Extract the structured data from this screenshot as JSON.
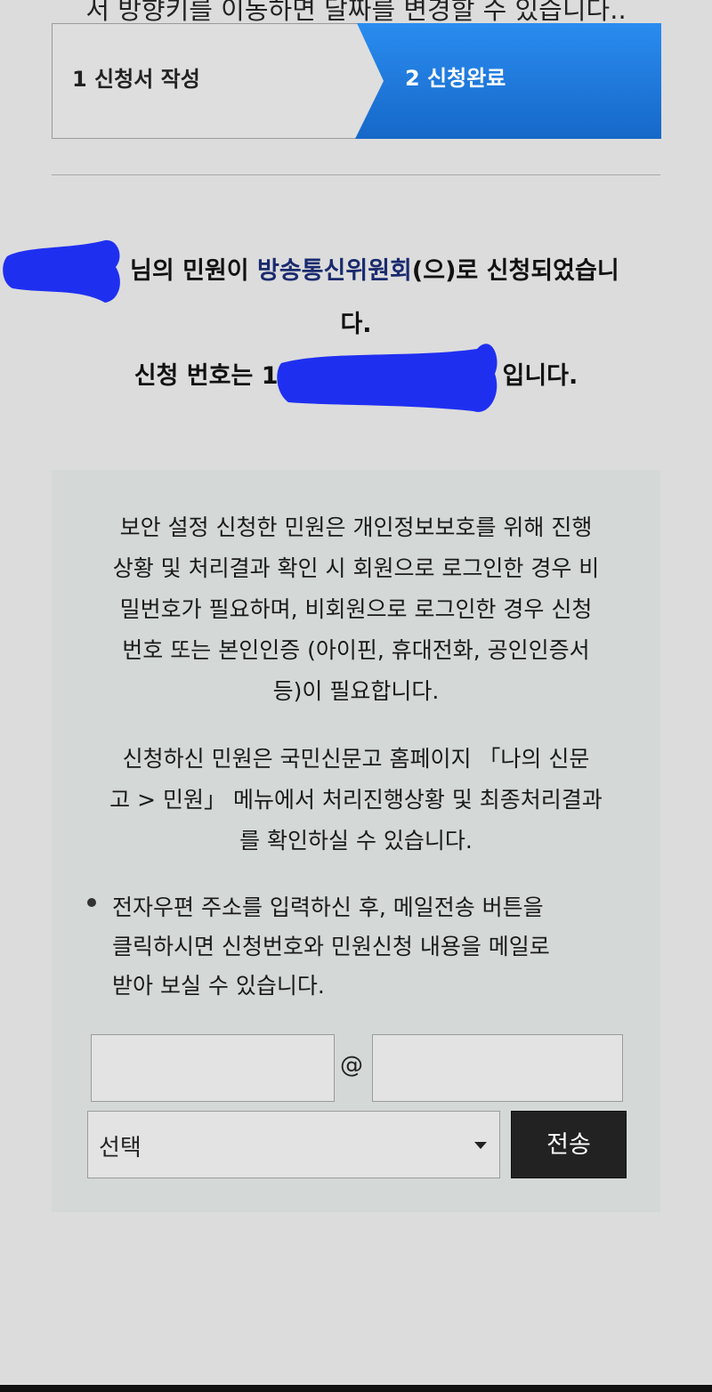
{
  "top_text": "서 방향키를 이동하면 달짜를 변경할 수 있습니다..",
  "steps": [
    {
      "label": "1 신청서 작성"
    },
    {
      "label": "2 신청완료"
    }
  ],
  "result": {
    "line1_prefix": "님의 민원이 ",
    "agency": "방송통신위원회",
    "line1_suffix": "(으)로 신청되었습니",
    "line2": "다.",
    "line3_prefix": "신청 번호는 1",
    "line3_suffix": "입니다."
  },
  "info": {
    "paragraph1_lines": [
      "보안 설정 신청한 민원은 개인정보보호를 위해 진행",
      "상황 및 처리결과 확인 시 회원으로 로그인한 경우 비",
      "밀번호가 필요하며, 비회원으로 로그인한 경우 신청",
      "번호 또는 본인인증 (아이핀, 휴대전화, 공인인증서",
      "등)이 필요합니다."
    ],
    "paragraph2_lines": [
      "신청하신 민원은 국민신문고 홈페이지 「나의 신문",
      "고 > 민원」 메뉴에서 처리진행상황 및 최종처리결과",
      "를 확인하실 수 있습니다."
    ],
    "bullet_lines": [
      "전자우편 주소를 입력하신 후, 메일전송 버튼을",
      "클릭하시면 신청번호와 민원신청 내용을 메일로",
      "받아 보실 수 있습니다."
    ]
  },
  "email_form": {
    "local_value": "",
    "domain_value": "",
    "at_symbol": "@",
    "select_label": "선택",
    "send_label": "전송"
  },
  "colors": {
    "active_step": "#1f7fe0",
    "send_button": "#222222",
    "redaction": "#1f2ff0"
  }
}
